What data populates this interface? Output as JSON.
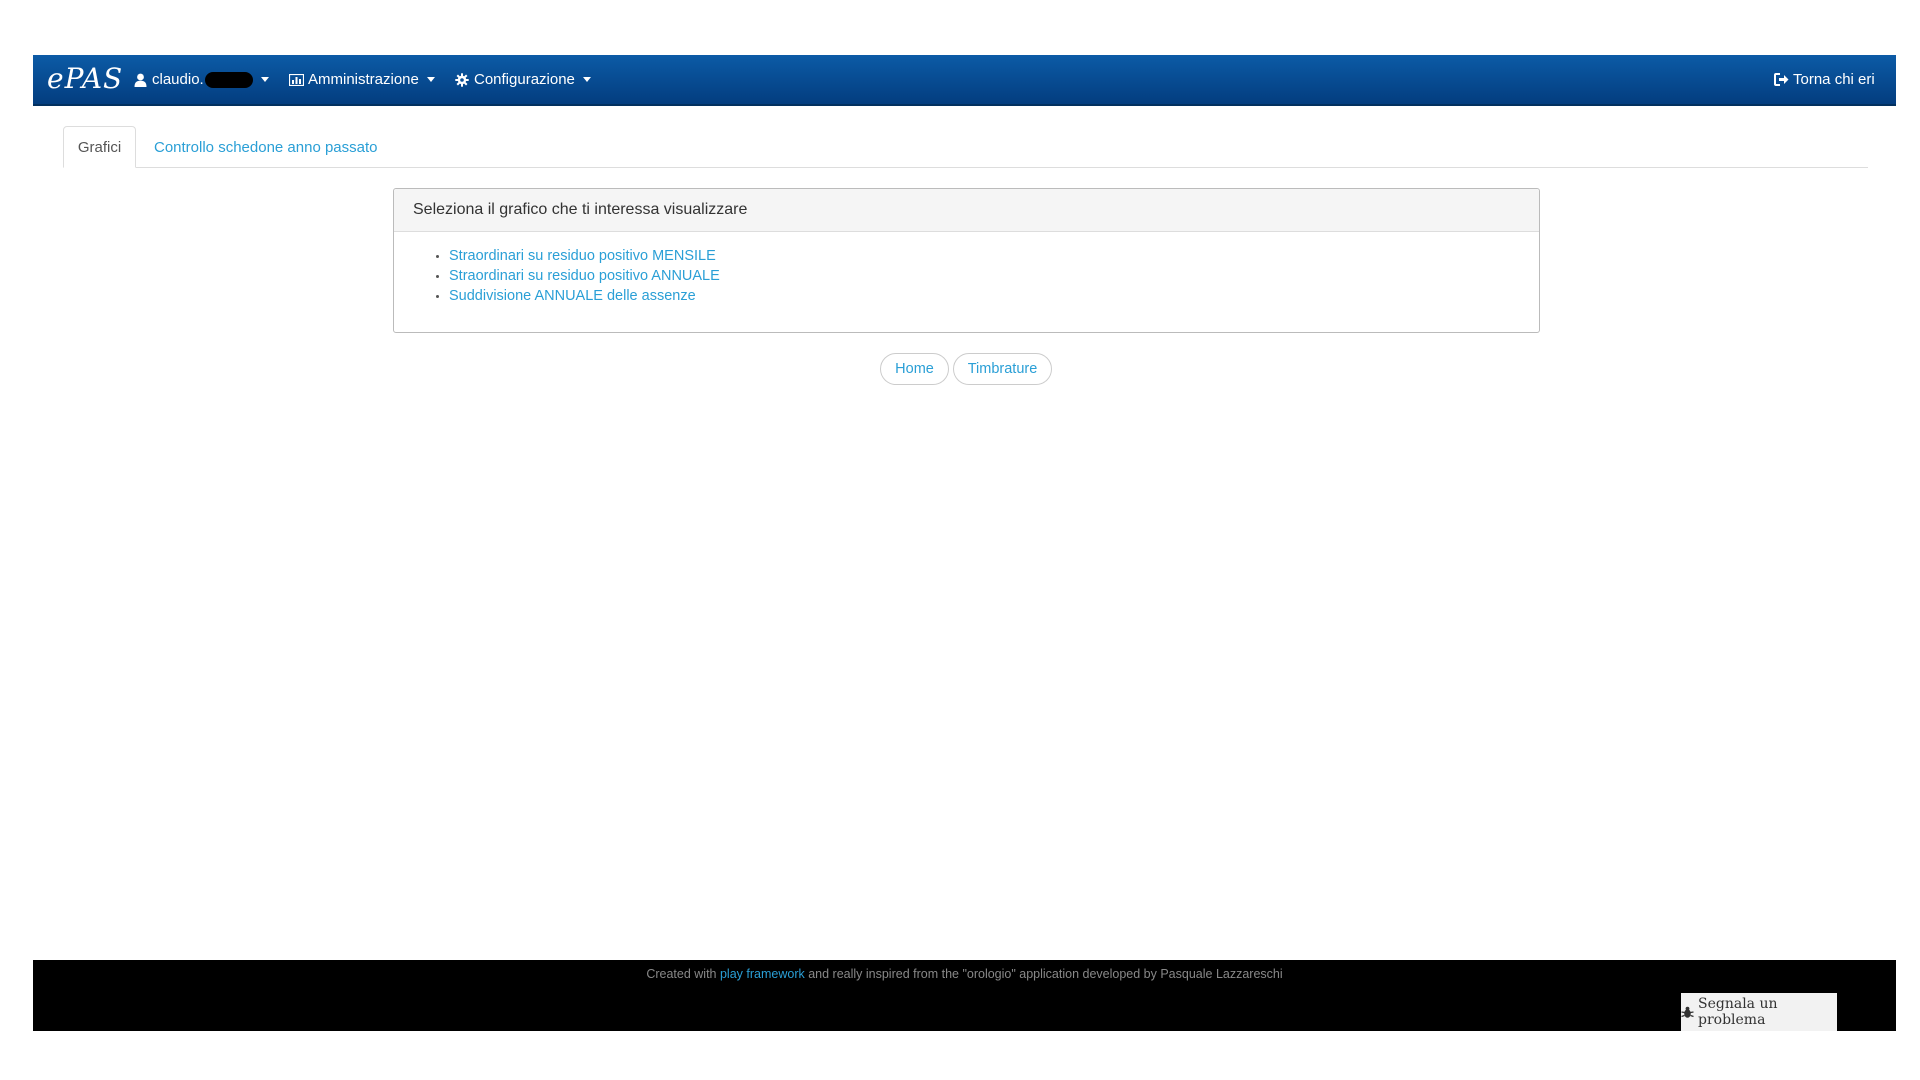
{
  "navbar": {
    "brand": "ePAS",
    "user_label": "claudio.",
    "admin_label": "Amministrazione",
    "config_label": "Configurazione",
    "back_label": "Torna chi eri",
    "icons": {
      "user": "user-icon",
      "admin": "bar-chart-icon",
      "config": "gear-icon",
      "back": "sign-out-icon"
    }
  },
  "tabs": [
    {
      "label": "Grafici",
      "active": true
    },
    {
      "label": "Controllo schedone anno passato",
      "active": false
    }
  ],
  "panel": {
    "heading": "Seleziona il grafico che ti interessa visualizzare",
    "links": [
      "Straordinari su residuo positivo MENSILE",
      "Straordinari su residuo positivo ANNUALE",
      "Suddivisione ANNUALE delle assenze"
    ]
  },
  "buttons": {
    "home": "Home",
    "timbrature": "Timbrature"
  },
  "footer": {
    "prefix": "Created with ",
    "link": "play framework",
    "suffix": " and really inspired from the \"orologio\" application developed by Pasquale Lazzareschi",
    "report_label": "Segnala un problema",
    "report_icon": "bug-icon"
  },
  "colors": {
    "navbar": "#0a4f97",
    "link": "#2a9fd6",
    "footer": "#000000"
  }
}
